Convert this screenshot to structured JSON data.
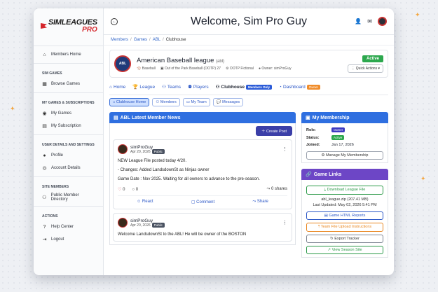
{
  "app": {
    "logo_line1": "SIMLEAGUES",
    "logo_line2": "PRO",
    "welcome": "Welcome, Sim Pro Guy",
    "back_icon": "back-arrow-icon"
  },
  "breadcrumb": [
    "Members",
    "Games",
    "ABL",
    "Clubhouse"
  ],
  "sidebar": {
    "members_home": "Members Home",
    "sections": [
      {
        "title": "SIM GAMES",
        "items": [
          "Browse Games"
        ]
      },
      {
        "title": "MY GAMES & SUBSCRIPTIONS",
        "items": [
          "My Games",
          "My Subscription"
        ]
      },
      {
        "title": "USER DETAILS AND SETTINGS",
        "items": [
          "Profile",
          "Account Details"
        ]
      },
      {
        "title": "SITE MEMBERS",
        "items": [
          "Public Member Directory"
        ]
      },
      {
        "title": "ACTIONS",
        "items": [
          "Help Center",
          "Logout"
        ]
      }
    ]
  },
  "league": {
    "name": "American Baseball league",
    "abbr": "(abl)",
    "sport": "Baseball",
    "game": "Out of the Park Baseball (OOTP) 27",
    "type": "OOTP Fictional",
    "owner": "Owner: simProGuy",
    "status": "Active",
    "quick_actions": "Quick Actions",
    "logo_text": "ABL"
  },
  "tabs": {
    "home": "Home",
    "league": "League",
    "teams": "Teams",
    "players": "Players",
    "clubhouse": "Clubhouse",
    "clubhouse_pill": "Members Only",
    "dashboard": "Dashboard",
    "dashboard_pill": "Owner"
  },
  "subtabs": [
    "Clubhouse Home",
    "Members",
    "My Team",
    "Messages"
  ],
  "news": {
    "title": "ABL Latest Member News",
    "create_post": "Create Post",
    "posts": [
      {
        "author": "simProGuy",
        "date": "Apr 20, 2026",
        "visibility": "Public",
        "lines": [
          "NEW League File posted today 4/20.",
          "- Changes: Added LandsdownSt as Ninjas owner",
          "Game Date : Nov 2025. Waiting for all owners to advance to the pre-season."
        ],
        "likes": "0",
        "comments": "0",
        "shares": "0 shares",
        "react": "React",
        "comment": "Comment",
        "share": "Share"
      },
      {
        "author": "simProGuy",
        "date": "Apr 20, 2026",
        "visibility": "Public",
        "lines": [
          "Welcome LandsdownSt to the ABL! He will be owner of the BOSTON"
        ]
      }
    ]
  },
  "membership": {
    "title": "My Membership",
    "role_label": "Role:",
    "role": "Owner",
    "status_label": "Status:",
    "status": "Active",
    "joined_label": "Joined:",
    "joined": "Jan 17, 2026",
    "manage": "Manage My Membership"
  },
  "game_links": {
    "title": "Game Links",
    "download": "Download League File",
    "file_name": "abl_league.zip (207.41 MB)",
    "last_updated": "Last Updated: May 02, 2026 5:41 PM",
    "html_reports": "Game HTML Reports",
    "upload_instructions": "Team File Upload Instructions",
    "export_tracker": "Export Tracker",
    "season_site": "View Season Site"
  }
}
